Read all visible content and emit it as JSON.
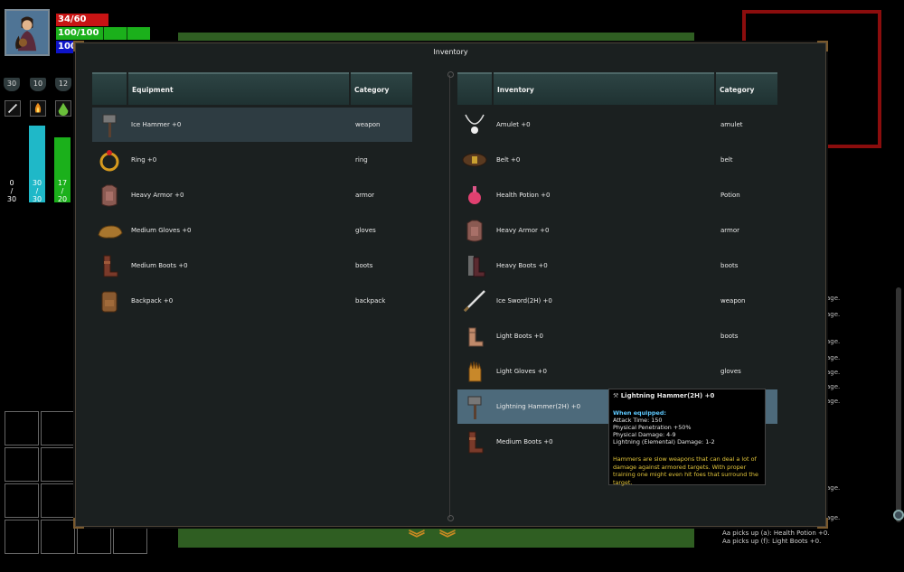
{
  "hud": {
    "hp": "34/60",
    "stamina": "100/100",
    "mana": "100",
    "badges": [
      "30",
      "10",
      "12"
    ],
    "resource_bars": [
      {
        "top": "0",
        "mid": "/",
        "bot": "30",
        "fill": 0,
        "color": "#1fb8c8"
      },
      {
        "top": "30",
        "mid": "/",
        "bot": "30",
        "fill": 1,
        "color": "#1fb8c8"
      },
      {
        "top": "17",
        "mid": "/",
        "bot": "20",
        "fill": 0.85,
        "color": "#1bb01b"
      }
    ]
  },
  "window": {
    "title": "Inventory"
  },
  "equipment": {
    "header": "Equipment",
    "category_header": "Category",
    "items": [
      {
        "name": "Ice Hammer +0",
        "category": "weapon",
        "icon": "hammer-icon"
      },
      {
        "name": "Ring +0",
        "category": "ring",
        "icon": "ring-icon"
      },
      {
        "name": "Heavy Armor +0",
        "category": "armor",
        "icon": "armor-icon"
      },
      {
        "name": "Medium Gloves +0",
        "category": "gloves",
        "icon": "gloves-icon"
      },
      {
        "name": "Medium Boots +0",
        "category": "boots",
        "icon": "boots-icon"
      },
      {
        "name": "Backpack +0",
        "category": "backpack",
        "icon": "backpack-icon"
      }
    ]
  },
  "inventory": {
    "header": "Inventory",
    "category_header": "Category",
    "items": [
      {
        "name": "Amulet +0",
        "category": "amulet",
        "icon": "amulet-icon"
      },
      {
        "name": "Belt +0",
        "category": "belt",
        "icon": "belt-icon"
      },
      {
        "name": "Health Potion +0",
        "category": "Potion",
        "icon": "potion-icon"
      },
      {
        "name": "Heavy Armor +0",
        "category": "armor",
        "icon": "armor-icon"
      },
      {
        "name": "Heavy Boots +0",
        "category": "boots",
        "icon": "heavy-boots-icon"
      },
      {
        "name": "Ice Sword(2H) +0",
        "category": "weapon",
        "icon": "sword-icon"
      },
      {
        "name": "Light Boots +0",
        "category": "boots",
        "icon": "light-boots-icon"
      },
      {
        "name": "Light Gloves +0",
        "category": "gloves",
        "icon": "light-gloves-icon"
      },
      {
        "name": "Lightning Hammer(2H) +0",
        "category": "weapon",
        "icon": "hammer-icon"
      },
      {
        "name": "Medium Boots +0",
        "category": "boots",
        "icon": "boots-icon"
      }
    ]
  },
  "tooltip": {
    "title": "Lightning Hammer(2H) +0",
    "when_equipped": "When equipped:",
    "stats": [
      "Attack Time: 150",
      "Physical Penetration +50%",
      "Physical Damage: 4-9",
      "Lightning (Elemental) Damage: 1-2"
    ],
    "description": "Hammers are slow weapons that can deal a lot of damage against armored targets. With proper training one might even hit foes that surround the target."
  },
  "log": {
    "lines": [
      "Aa picks up (a): Health Potion +0.",
      "Aa picks up (f): Light Boots +0."
    ],
    "fragments": [
      "age.",
      "age.",
      "age.",
      "age.",
      "age.",
      "age.",
      "age.",
      "age.",
      "age."
    ]
  },
  "colors": {
    "hp": "#c81414",
    "stamina": "#1bb01b",
    "mana": "#0e14c8",
    "accent_border": "#8b0d0d"
  }
}
